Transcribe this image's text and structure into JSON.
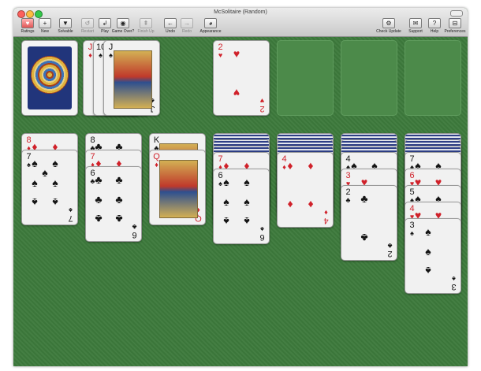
{
  "window": {
    "title": "McSolitaire (Random)",
    "traffic_light_colors": [
      "#fc605c",
      "#fdbc40",
      "#34c84a"
    ]
  },
  "toolbar": {
    "buttons": [
      {
        "key": "ratings",
        "label": "Ratings",
        "icon": "heart-icon",
        "glyph": "♥",
        "enabled": true
      },
      {
        "key": "new",
        "label": "New",
        "icon": "plus-icon",
        "glyph": "+",
        "enabled": true
      },
      {
        "key": "solvable",
        "label": "Solvable",
        "icon": "down-triangle-icon",
        "glyph": "▼",
        "enabled": true
      },
      {
        "key": "restart",
        "label": "Restart",
        "icon": "restart-icon",
        "glyph": "↺",
        "enabled": false
      },
      {
        "key": "play",
        "label": "Play",
        "icon": "play-icon",
        "glyph": "↲",
        "enabled": true
      },
      {
        "key": "game-over",
        "label": "Game Over?",
        "icon": "eye-icon",
        "glyph": "◉",
        "enabled": true
      },
      {
        "key": "finish-up",
        "label": "Finish Up",
        "icon": "finish-up-icon",
        "glyph": "⇞",
        "enabled": false
      },
      {
        "key": "undo",
        "label": "Undo",
        "icon": "undo-arrow-icon",
        "glyph": "←",
        "enabled": true
      },
      {
        "key": "redo",
        "label": "Redo",
        "icon": "redo-arrow-icon",
        "glyph": "→",
        "enabled": false
      },
      {
        "key": "appearance",
        "label": "Appearance",
        "icon": "appearance-eye-icon",
        "glyph": "◕",
        "enabled": true
      },
      {
        "key": "check-update",
        "label": "Check Update",
        "icon": "gear-icon",
        "glyph": "⚙",
        "enabled": true
      },
      {
        "key": "support",
        "label": "Support",
        "icon": "envelope-icon",
        "glyph": "✉",
        "enabled": true
      },
      {
        "key": "help",
        "label": "Help",
        "icon": "help-icon",
        "glyph": "?",
        "enabled": true
      },
      {
        "key": "preferences",
        "label": "Preferences",
        "icon": "switch-icon",
        "glyph": "⊟",
        "enabled": true
      }
    ]
  },
  "colors": {
    "felt": "#3d7a3c",
    "red_suit": "#d0212a",
    "black_suit": "#141414"
  },
  "board": {
    "stock": {
      "face_down": true,
      "icon": "card-back-mandala-icon"
    },
    "waste": [
      {
        "rank": "J",
        "suit": "♦",
        "color": "red"
      },
      {
        "rank": "10",
        "suit": "♠",
        "color": "black"
      },
      {
        "rank": "J",
        "suit": "♠",
        "color": "black"
      }
    ],
    "foundations": [
      {
        "rank": "2",
        "suit": "♥",
        "color": "red"
      },
      null,
      null,
      null
    ],
    "tableau": [
      {
        "hidden": 0,
        "cards": [
          {
            "rank": "8",
            "suit": "♦",
            "color": "red"
          },
          {
            "rank": "7",
            "suit": "♠",
            "color": "black"
          }
        ]
      },
      {
        "hidden": 0,
        "cards": [
          {
            "rank": "8",
            "suit": "♣",
            "color": "black"
          },
          {
            "rank": "7",
            "suit": "♦",
            "color": "red"
          },
          {
            "rank": "6",
            "suit": "♣",
            "color": "black"
          }
        ]
      },
      {
        "hidden": 0,
        "cards": [
          {
            "rank": "K",
            "suit": "♣",
            "color": "black"
          },
          {
            "rank": "Q",
            "suit": "♦",
            "color": "red"
          }
        ]
      },
      {
        "hidden": 3,
        "cards": [
          {
            "rank": "7",
            "suit": "♦",
            "color": "red"
          },
          {
            "rank": "6",
            "suit": "♠",
            "color": "black"
          }
        ]
      },
      {
        "hidden": 3,
        "cards": [
          {
            "rank": "4",
            "suit": "♦",
            "color": "red"
          }
        ]
      },
      {
        "hidden": 3,
        "cards": [
          {
            "rank": "4",
            "suit": "♠",
            "color": "black"
          },
          {
            "rank": "3",
            "suit": "♥",
            "color": "red"
          },
          {
            "rank": "2",
            "suit": "♣",
            "color": "black"
          }
        ]
      },
      {
        "hidden": 3,
        "cards": [
          {
            "rank": "7",
            "suit": "♠",
            "color": "black"
          },
          {
            "rank": "6",
            "suit": "♥",
            "color": "red"
          },
          {
            "rank": "5",
            "suit": "♠",
            "color": "black"
          },
          {
            "rank": "4",
            "suit": "♥",
            "color": "red"
          },
          {
            "rank": "3",
            "suit": "♠",
            "color": "black"
          }
        ]
      }
    ]
  }
}
